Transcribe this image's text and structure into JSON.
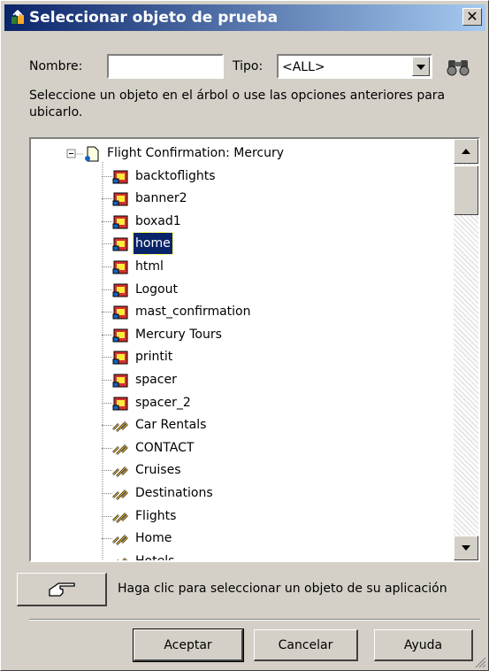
{
  "window": {
    "title": "Seleccionar objeto de prueba",
    "close_label": "✕"
  },
  "filter": {
    "nombre_label": "Nombre:",
    "nombre_value": "",
    "tipo_label": "Tipo:",
    "tipo_value": "<ALL>"
  },
  "description": "Seleccione un objeto en el árbol o use las opciones anteriores para ubicarlo.",
  "tree": {
    "root": "Flight Confirmation: Mercury",
    "selected_index": 3,
    "images": [
      "backtoflights",
      "banner2",
      "boxad1",
      "home",
      "html",
      "Logout",
      "mast_confirmation",
      "Mercury Tours",
      "printit",
      "spacer",
      "spacer_2"
    ],
    "links": [
      "Car Rentals",
      "CONTACT",
      "Cruises",
      "Destinations",
      "Flights",
      "Home",
      "Hotels"
    ]
  },
  "pointer": {
    "label": "Haga clic para seleccionar un objeto de su aplicación"
  },
  "buttons": {
    "ok": "Aceptar",
    "cancel": "Cancelar",
    "help": "Ayuda"
  },
  "icons": {
    "title": "test-object-icon",
    "search": "binoculars-icon",
    "pointer": "pointing-hand-icon",
    "page": "page-icon",
    "image": "image-icon",
    "link": "link-icon"
  },
  "colors": {
    "titlebar": "#0a246a",
    "selection": "#0a246a",
    "face": "#d4d0c8"
  }
}
